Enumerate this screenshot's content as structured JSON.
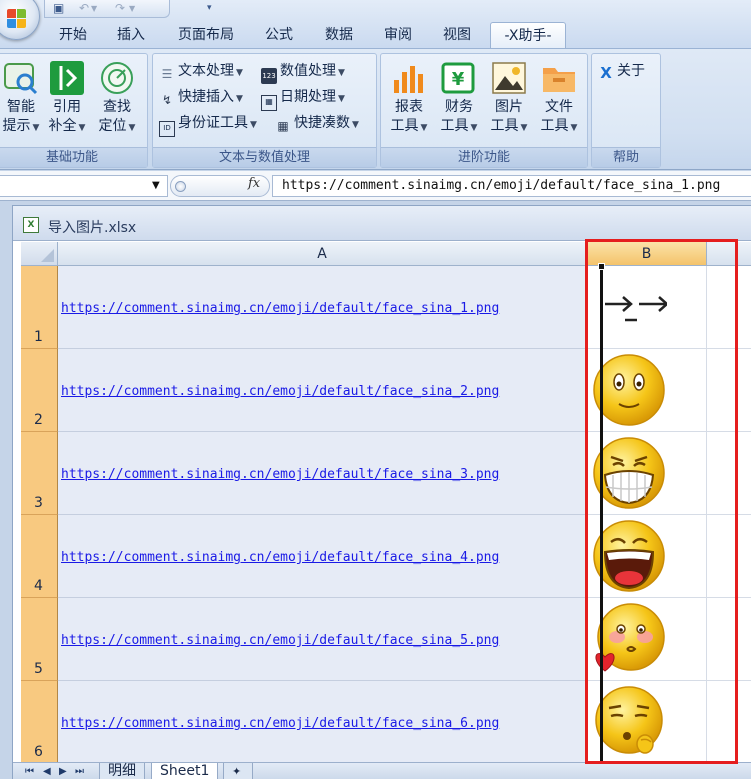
{
  "title_bar": {
    "qat_icons": [
      "save-icon",
      "undo-icon",
      "redo-icon",
      "customize-icon"
    ],
    "tabs": [
      {
        "label": "开始"
      },
      {
        "label": "插入"
      },
      {
        "label": "页面布局"
      },
      {
        "label": "公式"
      },
      {
        "label": "数据"
      },
      {
        "label": "审阅"
      },
      {
        "label": "视图"
      },
      {
        "label": "-X助手-",
        "active": true
      }
    ]
  },
  "ribbon": {
    "groups": [
      {
        "label": "基础功能",
        "buttons": [
          {
            "line1": "智能",
            "line2": "提示",
            "icon": "search-magnifier-icon"
          },
          {
            "line1": "引用",
            "line2": "补全",
            "icon": "reference-complete-icon"
          },
          {
            "line1": "查找",
            "line2": "定位",
            "icon": "locate-target-icon"
          }
        ]
      },
      {
        "label": "文本与数值处理",
        "buttons": [
          {
            "label": "文本处理",
            "icon": "text-lines-icon"
          },
          {
            "label": "数值处理",
            "icon": "numbers-123-icon"
          },
          {
            "label": "快捷插入",
            "icon": "lightning-icon"
          },
          {
            "label": "日期处理",
            "icon": "calendar-icon"
          },
          {
            "label": "身份证工具",
            "icon": "id-card-icon"
          },
          {
            "label": "快捷凑数",
            "icon": "calculator-icon"
          }
        ]
      },
      {
        "label": "进阶功能",
        "buttons": [
          {
            "line1": "报表",
            "line2": "工具",
            "icon": "bar-chart-icon"
          },
          {
            "line1": "财务",
            "line2": "工具",
            "icon": "finance-yen-icon"
          },
          {
            "line1": "图片",
            "line2": "工具",
            "icon": "picture-icon"
          },
          {
            "line1": "文件",
            "line2": "工具",
            "icon": "folder-icon"
          }
        ]
      },
      {
        "label": "帮助",
        "buttons": [
          {
            "label": "关于",
            "icon": "x-logo-icon"
          }
        ]
      }
    ]
  },
  "formula_bar": {
    "name_box": "",
    "fx": "fx",
    "content": "https://comment.sinaimg.cn/emoji/default/face_sina_1.png"
  },
  "workbook": {
    "filename": "导入图片.xlsx",
    "columns": [
      "A",
      "B"
    ],
    "rows": [
      {
        "num": "1",
        "url": "https://comment.sinaimg.cn/emoji/default/face_sina_1.png",
        "picture": "arrow-face-emoji"
      },
      {
        "num": "2",
        "url": "https://comment.sinaimg.cn/emoji/default/face_sina_2.png",
        "picture": "smile-face-emoji"
      },
      {
        "num": "3",
        "url": "https://comment.sinaimg.cn/emoji/default/face_sina_3.png",
        "picture": "grin-face-emoji"
      },
      {
        "num": "4",
        "url": "https://comment.sinaimg.cn/emoji/default/face_sina_4.png",
        "picture": "laugh-face-emoji"
      },
      {
        "num": "5",
        "url": "https://comment.sinaimg.cn/emoji/default/face_sina_5.png",
        "picture": "love-face-emoji"
      },
      {
        "num": "6",
        "url": "https://comment.sinaimg.cn/emoji/default/face_sina_6.png",
        "picture": "thinking-face-emoji"
      }
    ],
    "sheet_tabs": [
      {
        "label": "明细"
      },
      {
        "label": "Sheet1",
        "active": true
      }
    ]
  },
  "colors": {
    "highlight_box": "#e51e1e",
    "selected_header": "#f8c980",
    "link": "#1a1ae6",
    "emoji_yellow": "#f5c518"
  }
}
